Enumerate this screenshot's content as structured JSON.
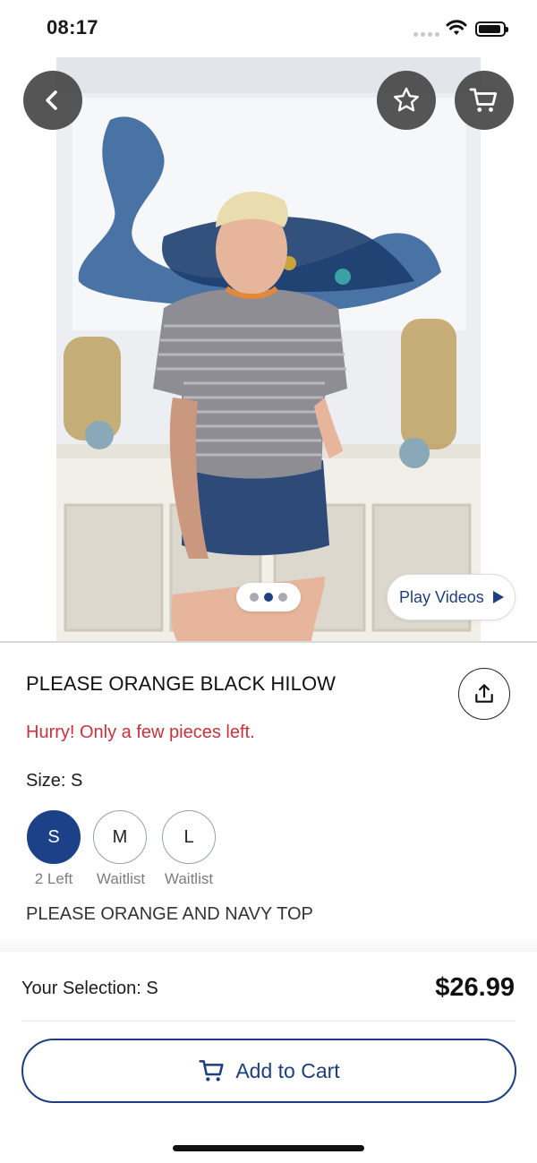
{
  "status_bar": {
    "time": "08:17"
  },
  "hero": {
    "icons": {
      "back": "chevron-left-icon",
      "favorite": "star-icon",
      "cart": "shopping-cart-icon"
    },
    "pager": {
      "total": 3,
      "active_index": 1
    },
    "play_videos_label": "Play Videos"
  },
  "product": {
    "title": "PLEASE ORANGE BLACK HILOW",
    "stock_note": "Hurry! Only a few pieces left.",
    "size_label": "Size: S",
    "sizes": [
      {
        "label": "S",
        "status": "2 Left",
        "selected": true
      },
      {
        "label": "M",
        "status": "Waitlist",
        "selected": false
      },
      {
        "label": "L",
        "status": "Waitlist",
        "selected": false
      }
    ],
    "description": "PLEASE ORANGE AND NAVY TOP"
  },
  "purchase": {
    "selection_text": "Your Selection: S",
    "price": "$26.99",
    "add_to_cart_label": "Add to Cart"
  },
  "colors": {
    "brand_navy": "#1d4189",
    "alert_red": "#c9323b"
  }
}
